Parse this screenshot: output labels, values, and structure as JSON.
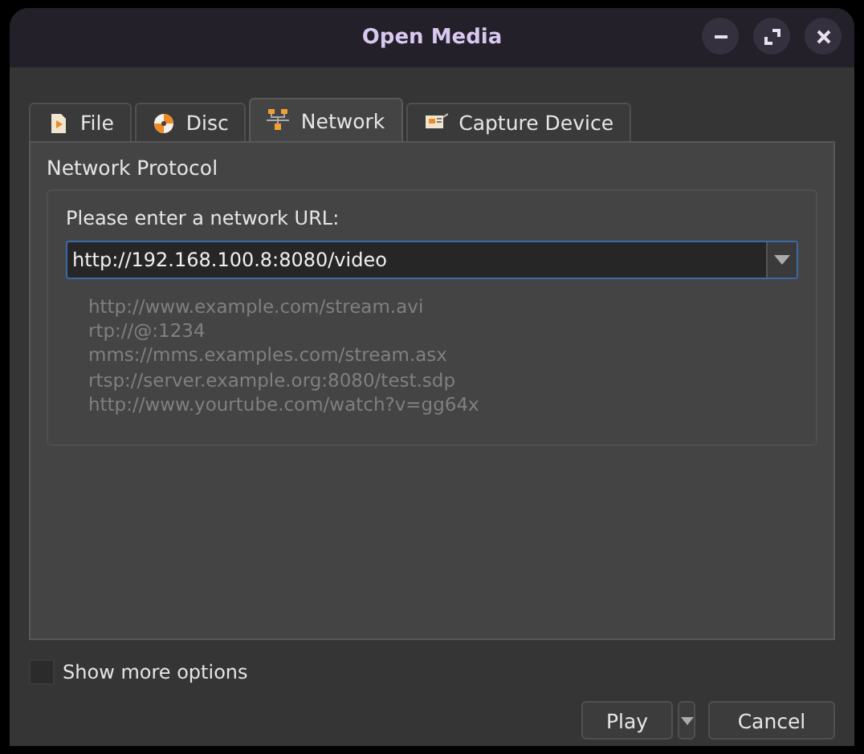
{
  "window": {
    "title": "Open Media"
  },
  "tabs": [
    {
      "label": "File",
      "selected": false
    },
    {
      "label": "Disc",
      "selected": false
    },
    {
      "label": "Network",
      "selected": true
    },
    {
      "label": "Capture Device",
      "selected": false
    }
  ],
  "section_title": "Network Protocol",
  "url_prompt": "Please enter a network URL:",
  "url_field": {
    "value": "http://192.168.100.8:8080/video"
  },
  "examples": [
    "http://www.example.com/stream.avi",
    "rtp://@:1234",
    "mms://mms.examples.com/stream.asx",
    "rtsp://server.example.org:8080/test.sdp",
    "http://www.yourtube.com/watch?v=gg64x"
  ],
  "show_more_options": {
    "label": "Show more options",
    "checked": false
  },
  "buttons": {
    "play": "Play",
    "cancel": "Cancel"
  }
}
